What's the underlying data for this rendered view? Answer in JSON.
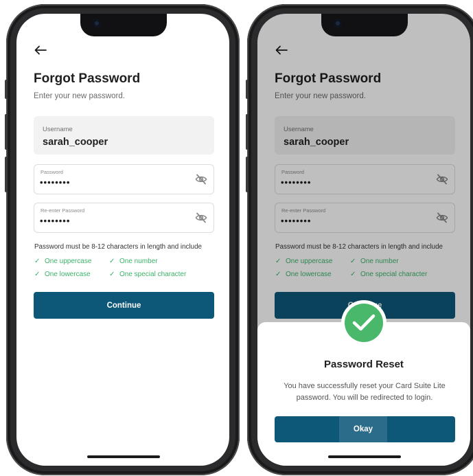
{
  "screens": [
    {
      "title": "Forgot Password",
      "subtitle": "Enter your new password.",
      "username_label": "Username",
      "username_value": "sarah_cooper",
      "password_label": "Password",
      "password_value": "••••••••",
      "reenter_label": "Re-enter Password",
      "reenter_value": "••••••••",
      "rule_text": "Password must be 8-12 characters in length and include",
      "checks": [
        "One uppercase",
        "One number",
        "One lowercase",
        "One special character"
      ],
      "continue_label": "Continue"
    },
    {
      "title": "Forgot Password",
      "subtitle": "Enter your new password.",
      "username_label": "Username",
      "username_value": "sarah_cooper",
      "password_label": "Password",
      "password_value": "••••••••",
      "reenter_label": "Re-enter Password",
      "reenter_value": "••••••••",
      "rule_text": "Password must be 8-12 characters in length and include",
      "checks": [
        "One uppercase",
        "One number",
        "One lowercase",
        "One special character"
      ],
      "continue_label": "Continue"
    }
  ],
  "modal": {
    "title": "Password Reset",
    "message": "You have successfully reset your Card Suite Lite  password. You will be redirected to login.",
    "okay_label": "Okay",
    "icon": "check-circle-icon"
  },
  "icons": {
    "back": "back-arrow-icon",
    "eye": "eye-off-icon",
    "check": "checkmark-icon"
  },
  "colors": {
    "primary": "#0d5878",
    "success": "#3bb36a",
    "field_bg": "#f2f2f2"
  }
}
